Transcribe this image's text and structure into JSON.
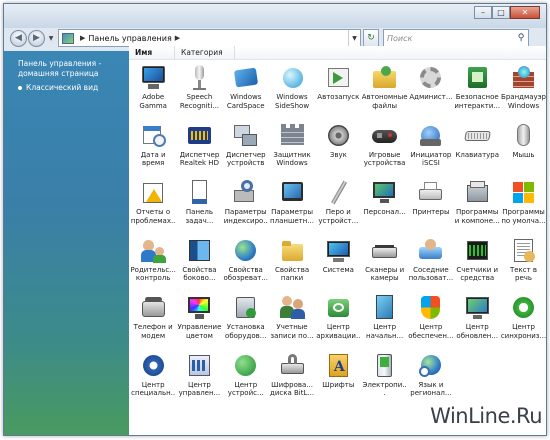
{
  "window": {
    "title_buttons": {
      "minimize": "–",
      "maximize": "□",
      "close": "✕"
    }
  },
  "address_bar": {
    "path_root": "Панель управления",
    "search_placeholder": "Поиск"
  },
  "left_pane": {
    "home_link": "Панель управления - домашняя страница",
    "classic_link": "Классический вид"
  },
  "columns": {
    "name": "Имя",
    "category": "Категория"
  },
  "items": [
    {
      "label": "Adobe Gamma",
      "icon": "monitor-icon"
    },
    {
      "label": "Speech Recogniti...",
      "icon": "microphone-icon"
    },
    {
      "label": "Windows CardSpace",
      "icon": "cardspace-icon"
    },
    {
      "label": "Windows SideShow",
      "icon": "sideshow-icon"
    },
    {
      "label": "Автозапуск",
      "icon": "autoplay-icon"
    },
    {
      "label": "Автономные файлы",
      "icon": "offline-files-icon"
    },
    {
      "label": "Админист...",
      "icon": "admin-tools-icon"
    },
    {
      "label": "Безопасное интеракти...",
      "icon": "safe-interaction-icon"
    },
    {
      "label": "Брандмауэр Windows",
      "icon": "firewall-icon"
    },
    {
      "label": "Дата и время",
      "icon": "calendar-clock-icon"
    },
    {
      "label": "Диспетчер Realtek HD",
      "icon": "realtek-icon"
    },
    {
      "label": "Диспетчер устройств",
      "icon": "device-manager-icon"
    },
    {
      "label": "Защитник Windows",
      "icon": "defender-icon"
    },
    {
      "label": "Звук",
      "icon": "speaker-icon"
    },
    {
      "label": "Игровые устройства",
      "icon": "gamepad-icon"
    },
    {
      "label": "Инициатор iSCSI",
      "icon": "iscsi-icon"
    },
    {
      "label": "Клавиатура",
      "icon": "keyboard-icon"
    },
    {
      "label": "Мышь",
      "icon": "mouse-icon"
    },
    {
      "label": "Отчеты о проблемах...",
      "icon": "problem-reports-icon"
    },
    {
      "label": "Панель задач...",
      "icon": "taskbar-icon"
    },
    {
      "label": "Параметры индексиро...",
      "icon": "indexing-icon"
    },
    {
      "label": "Параметры планшетн...",
      "icon": "tablet-icon"
    },
    {
      "label": "Перо и устройст...",
      "icon": "pen-icon"
    },
    {
      "label": "Персонал...",
      "icon": "personalization-icon"
    },
    {
      "label": "Принтеры",
      "icon": "printer-icon"
    },
    {
      "label": "Программы и компоне...",
      "icon": "programs-icon"
    },
    {
      "label": "Программы по умолча...",
      "icon": "default-programs-icon"
    },
    {
      "label": "Родительс... контроль",
      "icon": "parental-control-icon"
    },
    {
      "label": "Свойства боково...",
      "icon": "sidebar-props-icon"
    },
    {
      "label": "Свойства обозреват...",
      "icon": "internet-options-icon"
    },
    {
      "label": "Свойства папки",
      "icon": "folder-options-icon"
    },
    {
      "label": "Система",
      "icon": "system-icon"
    },
    {
      "label": "Сканеры и камеры",
      "icon": "scanner-icon"
    },
    {
      "label": "Соседние пользоват...",
      "icon": "people-near-me-icon"
    },
    {
      "label": "Счетчики и средства п...",
      "icon": "performance-icon"
    },
    {
      "label": "Текст в речь",
      "icon": "text-to-speech-icon"
    },
    {
      "label": "Телефон и модем",
      "icon": "phone-modem-icon"
    },
    {
      "label": "Управление цветом",
      "icon": "color-management-icon"
    },
    {
      "label": "Установка оборудов...",
      "icon": "add-hardware-icon"
    },
    {
      "label": "Учетные записи по...",
      "icon": "user-accounts-icon"
    },
    {
      "label": "Центр архивации...",
      "icon": "backup-center-icon"
    },
    {
      "label": "Центр начальн...",
      "icon": "welcome-center-icon"
    },
    {
      "label": "Центр обеспечен...",
      "icon": "security-center-icon"
    },
    {
      "label": "Центр обновлен...",
      "icon": "windows-update-icon"
    },
    {
      "label": "Центр синхрониз...",
      "icon": "sync-center-icon"
    },
    {
      "label": "Центр специальн...",
      "icon": "ease-of-access-icon"
    },
    {
      "label": "Центр управлен...",
      "icon": "network-center-icon"
    },
    {
      "label": "Центр устройс...",
      "icon": "mobile-device-icon"
    },
    {
      "label": "Шифрова... диска BitL...",
      "icon": "bitlocker-icon"
    },
    {
      "label": "Шрифты",
      "icon": "fonts-icon"
    },
    {
      "label": "Электропи...",
      "icon": "power-options-icon"
    },
    {
      "label": "Язык и регионал...",
      "icon": "regional-icon"
    }
  ],
  "watermark": "WinLine.Ru"
}
